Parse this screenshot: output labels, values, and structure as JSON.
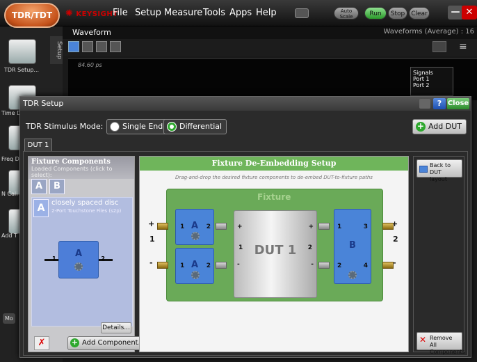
{
  "topbar": {
    "app_button": "TDR/TDT",
    "brand": "KEYSIGHT",
    "menus": [
      "File",
      "Setup",
      "Measure",
      "Tools",
      "Apps",
      "Help"
    ],
    "auto_scale": "Auto Scale",
    "run": "Run",
    "stop": "Stop",
    "clear": "Clear"
  },
  "background": {
    "waveform_tab": "Waveform",
    "waveforms_status": "Waveforms (Average) : 16",
    "setup_tab": "Setup",
    "rail_labels": [
      "TDR Setup...",
      "Time De",
      "Freq De",
      "N Cali",
      "Add T",
      "Mo"
    ],
    "time_marker": "84.60 ps",
    "signals_title": "Signals",
    "signals": [
      "Port 1",
      "Port 2"
    ]
  },
  "dialog": {
    "title": "TDR Setup",
    "help": "?",
    "close": "Close",
    "stimulus_label": "TDR Stimulus Mode:",
    "single_ended": "Single Ended",
    "differential": "Differential",
    "add_dut": "Add DUT",
    "dut_tab": "DUT 1"
  },
  "fixture_components": {
    "title": "Fixture Components",
    "subtitle": "Loaded Components (click to select):",
    "btn_a": "A",
    "btn_b": "B",
    "item_letter": "A",
    "item_name": "closely spaced disc",
    "item_type": "2-Port Touchstone Files (s2p)",
    "mini_label": "A",
    "mini_pin1": "1",
    "mini_pin2": "2",
    "details": "Details...",
    "delete": "✗",
    "add_component": "Add Component..."
  },
  "deembed": {
    "title": "Fixture De-Embedding Setup",
    "hint": "Drag-and-drop the desired fixture components to de-embed DUT-to-fixture paths",
    "fixture_label": "Fixture",
    "dut_label": "DUT 1",
    "block_a": "A",
    "block_b": "B",
    "port_left": "1",
    "port_right": "2",
    "plus": "+",
    "minus": "-",
    "pin_1": "1",
    "pin_2": "2",
    "pin_3": "3",
    "pin_4": "4"
  },
  "right_panel": {
    "back": "Back to DUT layout",
    "remove": "Remove All Components"
  },
  "colors": {
    "accent_green": "#6fb55b",
    "block_blue": "#4a84d8",
    "tdr_orange": "#c6531b"
  }
}
